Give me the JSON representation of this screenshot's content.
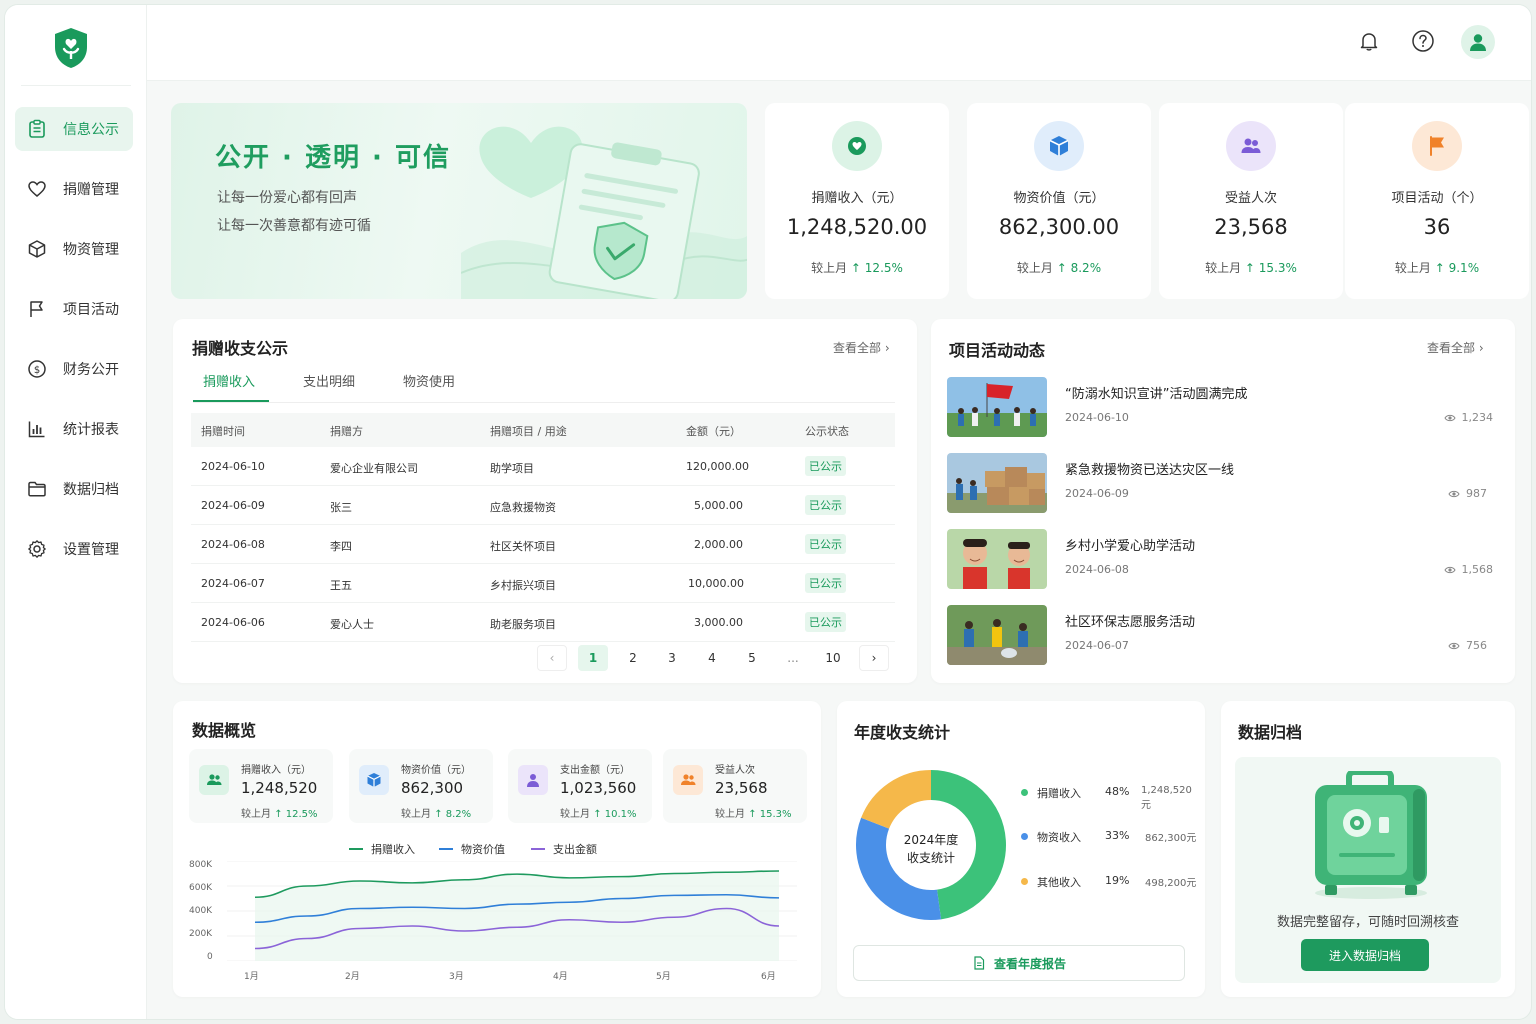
{
  "sidebar": {
    "items": [
      {
        "label": "信息公示",
        "icon": "clipboard-icon",
        "active": true
      },
      {
        "label": "捐赠管理",
        "icon": "heart-icon"
      },
      {
        "label": "物资管理",
        "icon": "box-icon"
      },
      {
        "label": "项目活动",
        "icon": "flag-icon"
      },
      {
        "label": "财务公开",
        "icon": "dollar-icon"
      },
      {
        "label": "统计报表",
        "icon": "bar-chart-icon"
      },
      {
        "label": "数据归档",
        "icon": "folder-icon"
      },
      {
        "label": "设置管理",
        "icon": "gear-icon"
      }
    ]
  },
  "topbar": {
    "icons": [
      "bell-icon",
      "help-icon",
      "user-icon"
    ]
  },
  "hero": {
    "title": "公开 · 透明 · 可信",
    "line1": "让每一份爱心都有回声",
    "line2": "让每一次善意都有迹可循"
  },
  "stats": [
    {
      "label": "捐赠收入（元）",
      "value": "1,248,520.00",
      "compare": "较上月",
      "change": "12.5%",
      "icon": "donation-icon",
      "color": "#1a9a5c"
    },
    {
      "label": "物资价值（元）",
      "value": "862,300.00",
      "compare": "较上月",
      "change": "8.2%",
      "icon": "package-icon",
      "color": "#2f7fd8"
    },
    {
      "label": "受益人次",
      "value": "23,568",
      "compare": "较上月",
      "change": "15.3%",
      "icon": "users-icon",
      "color": "#7b5cd6"
    },
    {
      "label": "项目活动（个）",
      "value": "36",
      "compare": "较上月",
      "change": "9.1%",
      "icon": "flag-icon",
      "color": "#f0822a"
    }
  ],
  "donations": {
    "title": "捐赠收支公示",
    "more": "查看全部",
    "tabs": [
      "捐赠收入",
      "支出明细",
      "物资使用"
    ],
    "columns": [
      "捐赠时间",
      "捐赠方",
      "捐赠项目 / 用途",
      "金额（元）",
      "公示状态"
    ],
    "rows": [
      [
        "2024-06-10",
        "爱心企业有限公司",
        "助学项目",
        "120,000.00",
        "已公示"
      ],
      [
        "2024-06-09",
        "张三",
        "应急救援物资",
        "5,000.00",
        "已公示"
      ],
      [
        "2024-06-08",
        "李四",
        "社区关怀项目",
        "2,000.00",
        "已公示"
      ],
      [
        "2024-06-07",
        "王五",
        "乡村振兴项目",
        "10,000.00",
        "已公示"
      ],
      [
        "2024-06-06",
        "爱心人士",
        "助老服务项目",
        "3,000.00",
        "已公示"
      ]
    ],
    "pages": [
      "1",
      "2",
      "3",
      "4",
      "5",
      "...",
      "10"
    ],
    "current_page": "1"
  },
  "activities": {
    "title": "项目活动动态",
    "more": "查看全部",
    "items": [
      {
        "title": "“防溺水知识宣讲”活动圆满完成",
        "date": "2024-06-10",
        "views": "1,234"
      },
      {
        "title": "紧急救援物资已送达灾区一线",
        "date": "2024-06-09",
        "views": "987"
      },
      {
        "title": "乡村小学爱心助学活动",
        "date": "2024-06-08",
        "views": "1,568"
      },
      {
        "title": "社区环保志愿服务活动",
        "date": "2024-06-07",
        "views": "756"
      }
    ]
  },
  "overview": {
    "title": "数据概览",
    "cards": [
      {
        "label": "捐赠收入（元）",
        "value": "1,248,520",
        "compare": "较上月",
        "change": "12.5%",
        "icon": "users-icon",
        "color": "#1a9a5c"
      },
      {
        "label": "物资价值（元）",
        "value": "862,300",
        "compare": "较上月",
        "change": "8.2%",
        "icon": "package-icon",
        "color": "#2f7fd8"
      },
      {
        "label": "支出金额（元）",
        "value": "1,023,560",
        "compare": "较上月",
        "change": "10.1%",
        "icon": "person-icon",
        "color": "#7b5cd6"
      },
      {
        "label": "受益人次",
        "value": "23,568",
        "compare": "较上月",
        "change": "15.3%",
        "icon": "users-icon",
        "color": "#f0822a"
      }
    ]
  },
  "line_chart_data": {
    "type": "line",
    "x": [
      "1月",
      "2月",
      "3月",
      "4月",
      "5月",
      "6月"
    ],
    "ylim": [
      0,
      800000
    ],
    "yticks": [
      "800K",
      "600K",
      "400K",
      "200K",
      "0"
    ],
    "series": [
      {
        "name": "捐赠收入",
        "color": "#1e9a5e",
        "values": [
          510000,
          600000,
          640000,
          625000,
          650000,
          695000,
          665000,
          675000,
          700000,
          710000,
          720000
        ]
      },
      {
        "name": "物资价值",
        "color": "#2f7fd8",
        "values": [
          310000,
          360000,
          420000,
          430000,
          420000,
          455000,
          470000,
          500000,
          525000,
          530000,
          505000
        ]
      },
      {
        "name": "支出金额",
        "color": "#8b64d8",
        "values": [
          100000,
          180000,
          260000,
          280000,
          240000,
          270000,
          330000,
          310000,
          350000,
          420000,
          280000
        ]
      }
    ]
  },
  "chart_data": {
    "type": "pie",
    "title": "年度收支统计",
    "center_label": "2024年度\n收支统计",
    "categories": [
      "捐赠收入",
      "物资收入",
      "其他收入"
    ],
    "values": [
      1248520,
      862300,
      498200
    ],
    "percent_labels": [
      "48%",
      "33%",
      "19%"
    ],
    "amount_labels": [
      "1,248,520元",
      "862,300元",
      "498,200元"
    ],
    "colors": [
      "#3cc27a",
      "#4a90e8",
      "#f5b84a"
    ]
  },
  "annual_center_line1": "2024年度",
  "annual_center_line2": "收支统计",
  "annual_report_button": "查看年度报告",
  "archive": {
    "title": "数据归档",
    "desc": "数据完整留存，可随时回溯核查",
    "button": "进入数据归档"
  }
}
